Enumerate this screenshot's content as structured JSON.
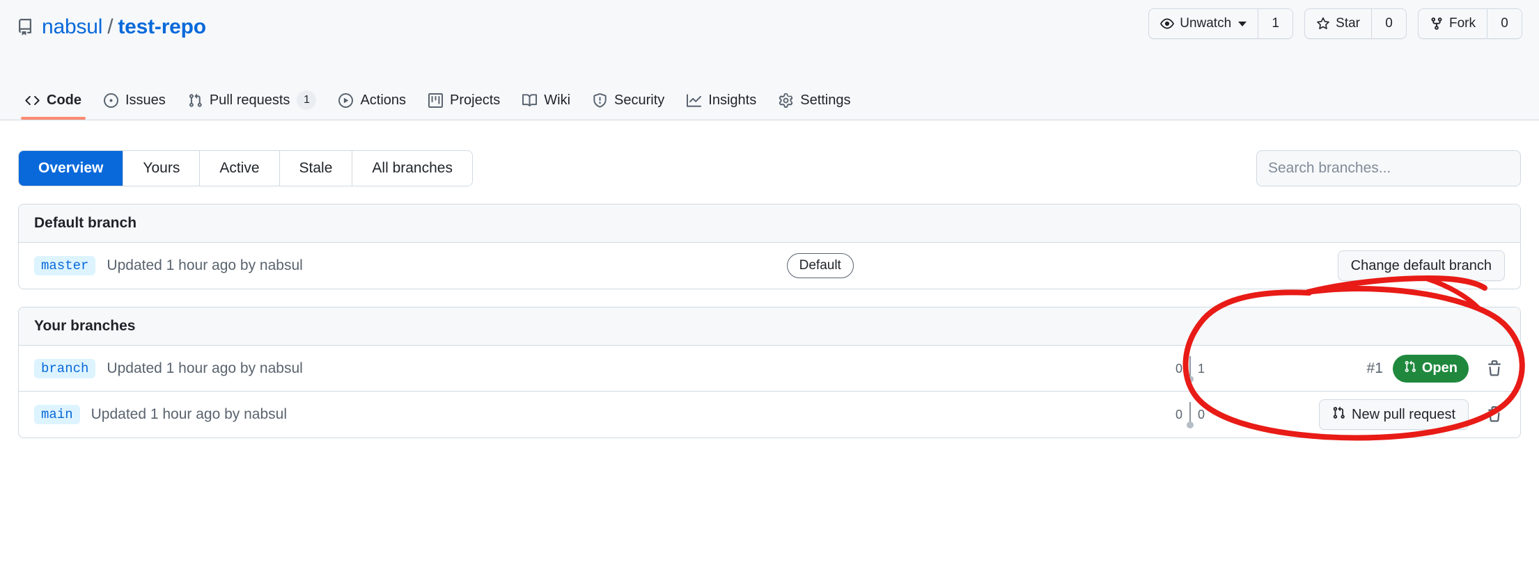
{
  "repo": {
    "icon": "repo-book-icon",
    "owner": "nabsul",
    "separator": "/",
    "name": "test-repo"
  },
  "repo_actions": [
    {
      "icon": "eye-icon",
      "label": "Unwatch",
      "count": "1",
      "has_caret": true
    },
    {
      "icon": "star-icon",
      "label": "Star",
      "count": "0",
      "has_caret": false
    },
    {
      "icon": "fork-icon",
      "label": "Fork",
      "count": "0",
      "has_caret": false
    }
  ],
  "repo_nav": [
    {
      "icon": "code-icon",
      "label": "Code",
      "badge": null,
      "active": true
    },
    {
      "icon": "issue-opened-icon",
      "label": "Issues",
      "badge": null,
      "active": false
    },
    {
      "icon": "git-pull-request-icon",
      "label": "Pull requests",
      "badge": "1",
      "active": false
    },
    {
      "icon": "play-icon",
      "label": "Actions",
      "badge": null,
      "active": false
    },
    {
      "icon": "project-icon",
      "label": "Projects",
      "badge": null,
      "active": false
    },
    {
      "icon": "book-icon",
      "label": "Wiki",
      "badge": null,
      "active": false
    },
    {
      "icon": "shield-icon",
      "label": "Security",
      "badge": null,
      "active": false
    },
    {
      "icon": "graph-icon",
      "label": "Insights",
      "badge": null,
      "active": false
    },
    {
      "icon": "gear-icon",
      "label": "Settings",
      "badge": null,
      "active": false
    }
  ],
  "filters": {
    "tabs": [
      {
        "label": "Overview",
        "active": true
      },
      {
        "label": "Yours",
        "active": false
      },
      {
        "label": "Active",
        "active": false
      },
      {
        "label": "Stale",
        "active": false
      },
      {
        "label": "All branches",
        "active": false
      }
    ],
    "search": {
      "placeholder": "Search branches...",
      "value": ""
    }
  },
  "default_branch_panel": {
    "title": "Default branch",
    "row": {
      "branch": "master",
      "meta": "Updated 1 hour ago by nabsul",
      "badge": "Default",
      "action_label": "Change default branch"
    }
  },
  "your_branches_panel": {
    "title": "Your branches",
    "rows": [
      {
        "branch": "branch",
        "meta": "Updated 1 hour ago by nabsul",
        "behind": "0",
        "ahead": "1",
        "pr_number": "#1",
        "state_label": "Open",
        "state_color": "#1f883d",
        "action_label": null,
        "delete_icon": "trash-icon"
      },
      {
        "branch": "main",
        "meta": "Updated 1 hour ago by nabsul",
        "behind": "0",
        "ahead": "0",
        "pr_number": null,
        "state_label": null,
        "state_color": null,
        "action_label": "New pull request",
        "delete_icon": "trash-icon"
      }
    ]
  },
  "annotation": {
    "type": "hand-drawn-ellipse",
    "color": "#e81b16",
    "target": "Change default branch"
  },
  "colors": {
    "accent_blue": "#0969da",
    "active_tab_underline": "#fd8c73",
    "open_green": "#1f883d",
    "annotation_red": "#e81b16"
  }
}
